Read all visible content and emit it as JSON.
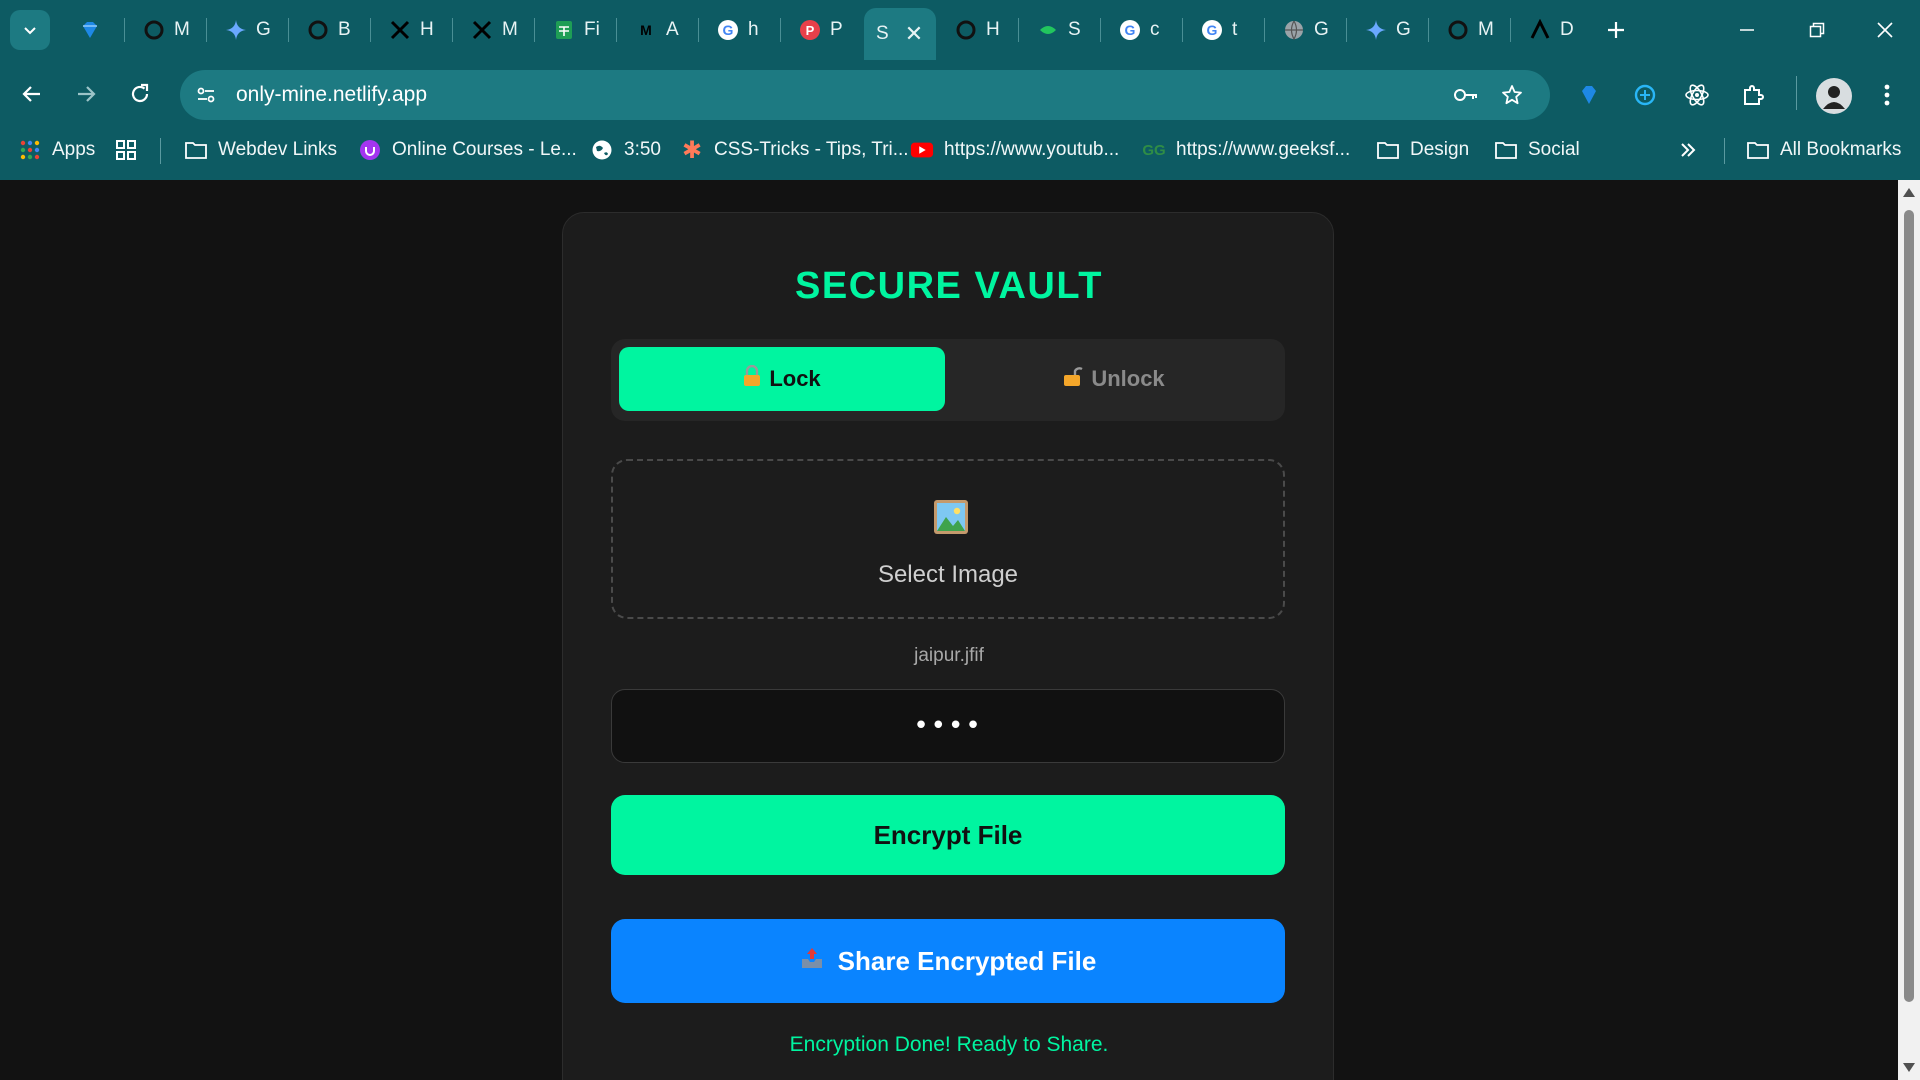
{
  "browser": {
    "tabs": [
      {
        "label": "",
        "icon": "gem-icon"
      },
      {
        "label": "M",
        "icon": "chatgpt-icon"
      },
      {
        "label": "G",
        "icon": "gemini-icon"
      },
      {
        "label": "B",
        "icon": "chatgpt-icon"
      },
      {
        "label": "H",
        "icon": "x-icon"
      },
      {
        "label": "M",
        "icon": "x-icon"
      },
      {
        "label": "Fi",
        "icon": "sheets-icon"
      },
      {
        "label": "A",
        "icon": "medium-icon"
      },
      {
        "label": "h",
        "icon": "google-icon"
      },
      {
        "label": "P",
        "icon": "pinterest-icon"
      },
      {
        "label": "S",
        "icon": "none",
        "active": true
      },
      {
        "label": "H",
        "icon": "chatgpt-icon"
      },
      {
        "label": "S",
        "icon": "deepseek-icon"
      },
      {
        "label": "c",
        "icon": "google-icon"
      },
      {
        "label": "t",
        "icon": "google-icon"
      },
      {
        "label": "G",
        "icon": "globe-icon"
      },
      {
        "label": "G",
        "icon": "gemini-icon"
      },
      {
        "label": "M",
        "icon": "chatgpt-icon"
      },
      {
        "label": "D",
        "icon": "anthropic-icon"
      }
    ],
    "url": "only-mine.netlify.app",
    "bookmarks": {
      "apps": "Apps",
      "webdev": "Webdev Links",
      "courses": "Online Courses - Le...",
      "time": "3:50",
      "csstricks": "CSS-Tricks - Tips, Tri...",
      "youtube": "https://www.youtub...",
      "geeks": "https://www.geeksf...",
      "design": "Design",
      "social": "Social",
      "all": "All Bookmarks"
    },
    "colors": {
      "chrome": "#0d5b63",
      "active_tab": "#1d7a82"
    }
  },
  "vault": {
    "title": "SECURE VAULT",
    "modes": {
      "lock": "Lock",
      "unlock": "Unlock",
      "selected": "Lock"
    },
    "dropzone_label": "Select Image",
    "file_name": "jaipur.jfif",
    "password_value": "••••",
    "encrypt_button": "Encrypt File",
    "share_button": "Share Encrypted File",
    "status": "Encryption Done! Ready to Share.",
    "colors": {
      "accent": "#00f5a0",
      "share": "#0a84ff",
      "card": "#1c1c1c",
      "background": "#121212"
    }
  }
}
